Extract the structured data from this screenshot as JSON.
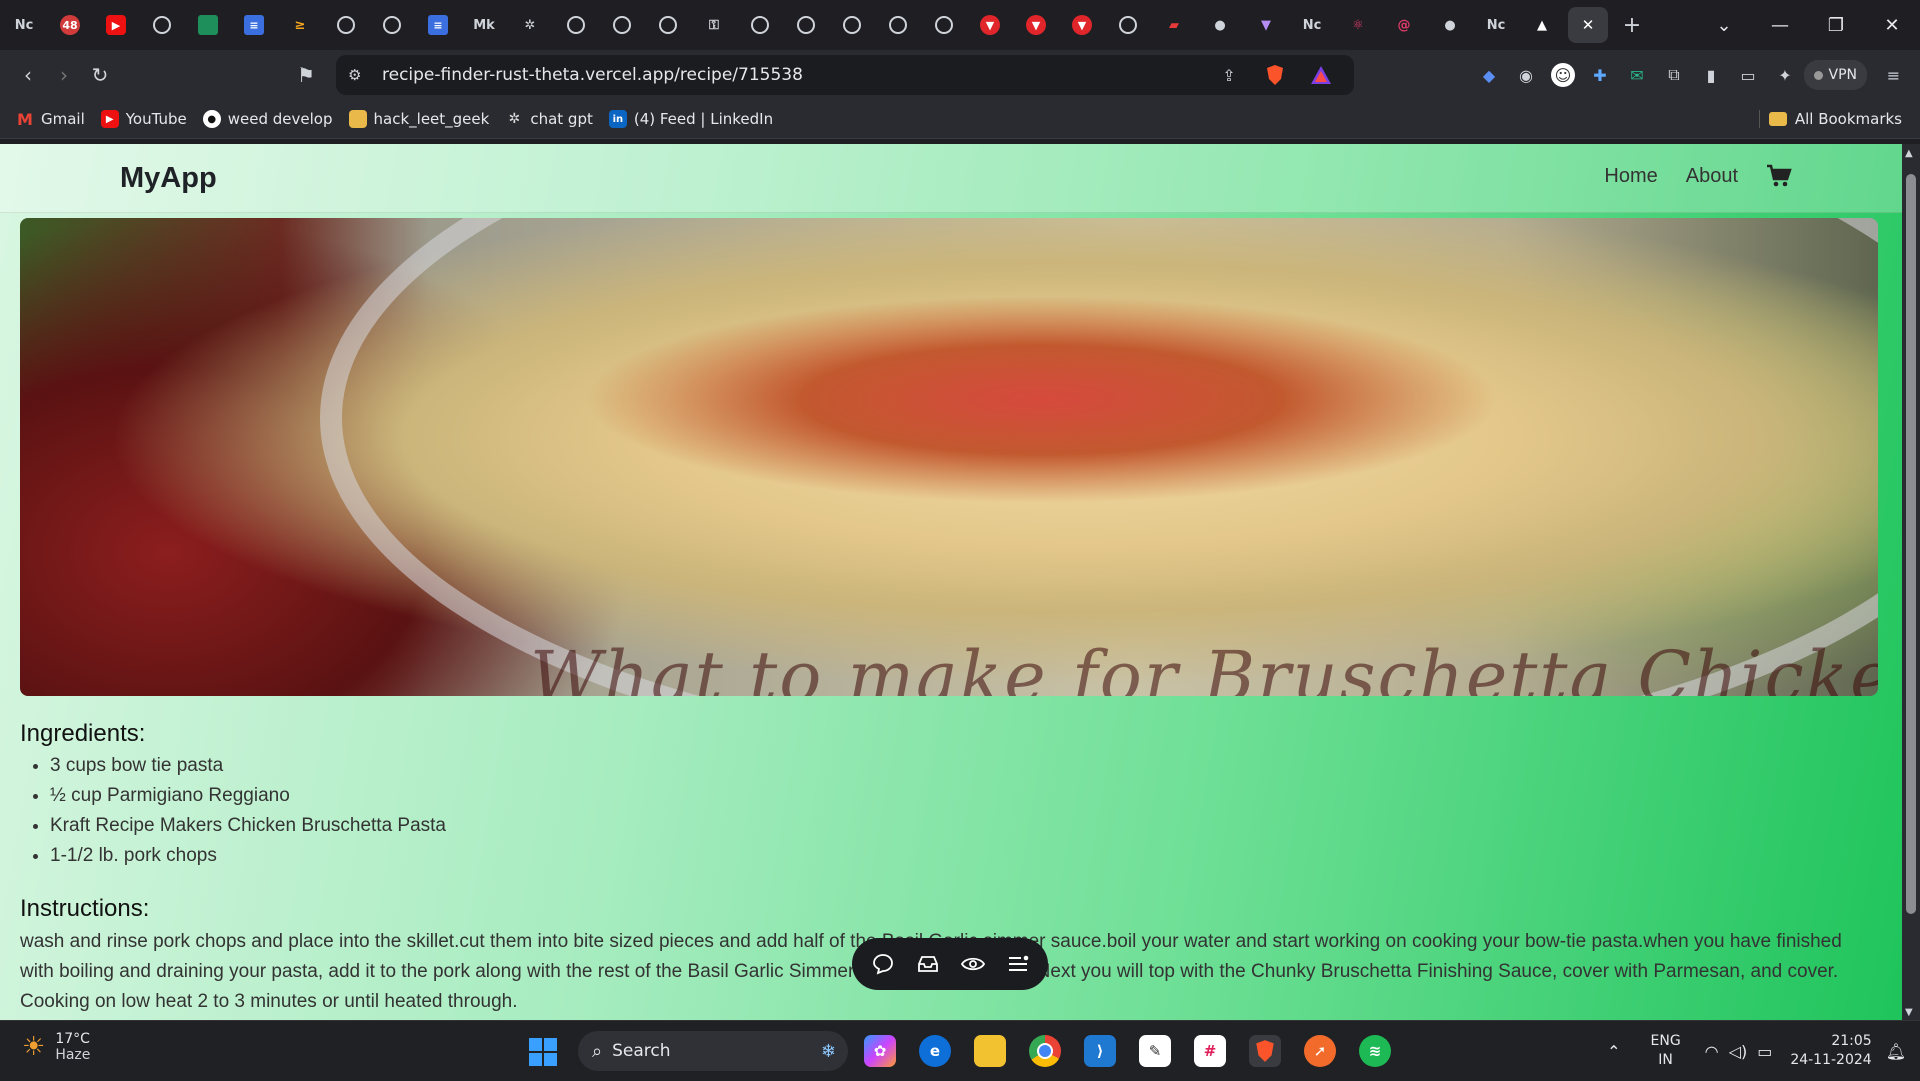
{
  "browser": {
    "tab_close": "✕",
    "new_tab": "+",
    "tab_labels": [
      "Nᴄ",
      "48",
      "Mk",
      "Nᴄ",
      "Nᴄ"
    ],
    "url": "recipe-finder-rust-theta.vercel.app/recipe/715538",
    "vpn_label": "VPN",
    "bookmarks": [
      {
        "label": "Gmail",
        "icon": "gmail-icon"
      },
      {
        "label": "YouTube",
        "icon": "youtube-icon"
      },
      {
        "label": "weed develop",
        "icon": "github-icon"
      },
      {
        "label": "hack_leet_geek",
        "icon": "folder-icon"
      },
      {
        "label": "chat gpt",
        "icon": "openai-icon"
      },
      {
        "label": "(4) Feed | LinkedIn",
        "icon": "linkedin-icon"
      }
    ],
    "all_bookmarks": "All Bookmarks"
  },
  "page": {
    "brand": "MyApp",
    "nav": {
      "home": "Home",
      "about": "About"
    },
    "hero_watermark": "What to make for Bruschetta Chicken",
    "ingredients_title": "Ingredients:",
    "ingredients": [
      "3 cups bow tie pasta",
      "½ cup Parmigiano Reggiano",
      "Kraft Recipe Makers Chicken Bruschetta Pasta",
      "1-1/2 lb. pork chops"
    ],
    "instructions_title": "Instructions:",
    "instructions": "wash and rinse pork chops and place into the skillet.cut them into bite sized pieces and add half of the Basil Garlic simmer sauce.boil your water and start working on cooking your bow-tie pasta.when you have finished with boiling and draining your pasta, add it to the pork along with the rest of the Basil Garlic Simmer Sauce, mixing lightly.Next you will top with the Chunky Bruschetta Finishing Sauce, cover with Parmesan, and cover. Cooking on low heat 2 to 3 minutes or until heated through."
  },
  "taskbar": {
    "temp": "17°C",
    "weather": "Haze",
    "search_placeholder": "Search",
    "lang_top": "ENG",
    "lang_bottom": "IN",
    "time": "21:05",
    "date": "24-11-2024"
  },
  "colors": {
    "accent_green": "#1fc45c",
    "page_light": "#d9f6e2"
  }
}
